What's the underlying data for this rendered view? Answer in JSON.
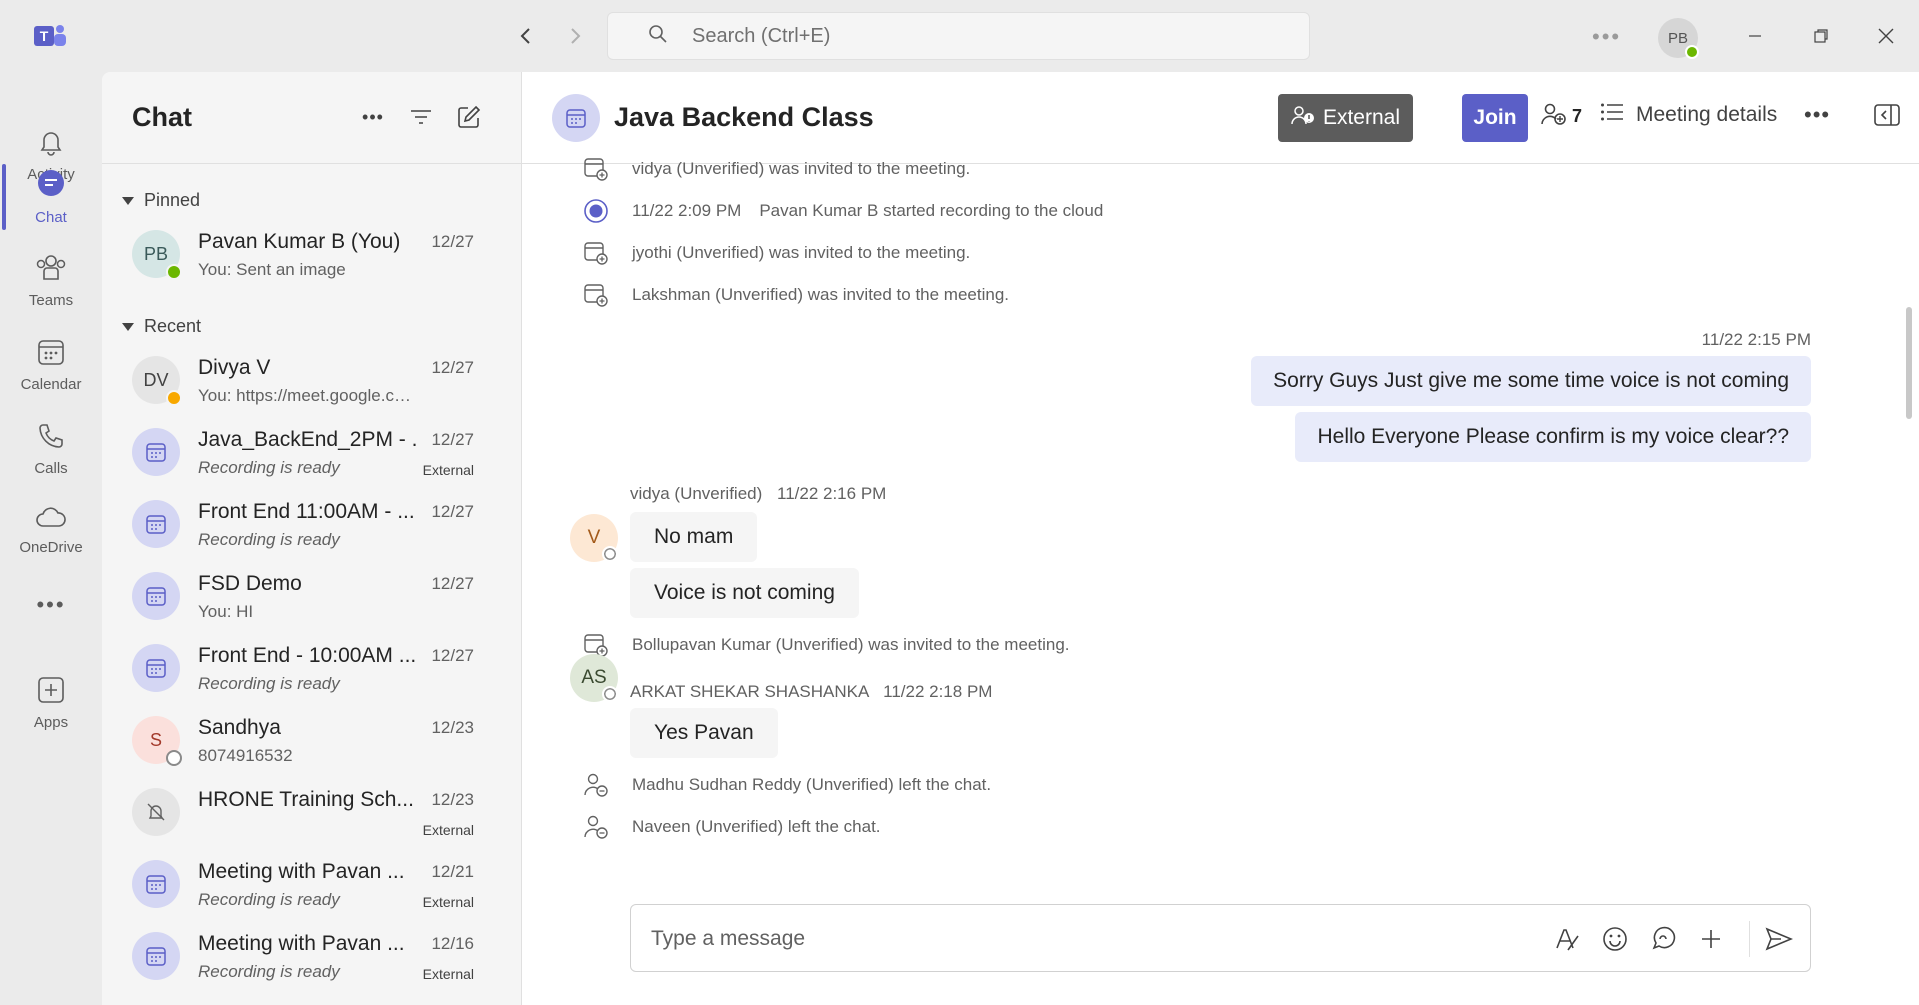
{
  "search": {
    "placeholder": "Search (Ctrl+E)"
  },
  "user": {
    "initials": "PB"
  },
  "rail": [
    {
      "label": "Activity",
      "icon": "bell-icon"
    },
    {
      "label": "Chat",
      "icon": "chat-icon",
      "active": true
    },
    {
      "label": "Teams",
      "icon": "teams-icon"
    },
    {
      "label": "Calendar",
      "icon": "calendar-icon"
    },
    {
      "label": "Calls",
      "icon": "phone-icon"
    },
    {
      "label": "OneDrive",
      "icon": "cloud-icon"
    },
    {
      "label": "...",
      "icon": "more-icon"
    },
    {
      "label": "Apps",
      "icon": "add-app-icon"
    }
  ],
  "chatlist": {
    "title": "Chat",
    "pinned_label": "Pinned",
    "recent_label": "Recent",
    "pinned": [
      {
        "name": "Pavan Kumar B (You)",
        "preview": "You: Sent an image",
        "date": "12/27",
        "initials": "PB",
        "status": "available"
      }
    ],
    "recent": [
      {
        "name": "Divya V",
        "preview": "You: https://meet.google.com/p...",
        "date": "12/27",
        "initials": "DV",
        "status": "away",
        "type": "person"
      },
      {
        "name": "Java_BackEnd_2PM - ...",
        "preview": "Recording is ready",
        "date": "12/27",
        "external": "External",
        "type": "meeting"
      },
      {
        "name": "Front End 11:00AM - ...",
        "preview": "Recording is ready",
        "date": "12/27",
        "type": "meeting"
      },
      {
        "name": "FSD Demo",
        "preview": "You: HI",
        "date": "12/27",
        "type": "meeting"
      },
      {
        "name": "Front End - 10:00AM ...",
        "preview": "Recording is ready",
        "date": "12/27",
        "type": "meeting"
      },
      {
        "name": "Sandhya",
        "preview": "8074916532",
        "date": "12/23",
        "initials": "S",
        "status": "offline",
        "type": "person"
      },
      {
        "name": "HRONE Training Sch...",
        "preview": "",
        "date": "12/23",
        "external": "External",
        "type": "muted"
      },
      {
        "name": "Meeting with Pavan ...",
        "preview": "Recording is ready",
        "date": "12/21",
        "external": "External",
        "type": "meeting"
      },
      {
        "name": "Meeting with Pavan ...",
        "preview": "Recording is ready",
        "date": "12/16",
        "external": "External",
        "type": "meeting"
      }
    ]
  },
  "conversation": {
    "title": "Java Backend Class",
    "external_label": "External",
    "join_label": "Join",
    "participants": "7",
    "details_label": "Meeting details",
    "system_events": [
      {
        "text": "vidya (Unverified) was invited to the meeting.",
        "icon": "invite-icon"
      },
      {
        "time": "11/22 2:09 PM",
        "text": "Pavan Kumar B started recording to the cloud",
        "icon": "record-icon"
      },
      {
        "text": "jyothi (Unverified) was invited to the meeting.",
        "icon": "invite-icon"
      },
      {
        "text": "Lakshman (Unverified) was invited to the meeting.",
        "icon": "invite-icon"
      }
    ],
    "my_time": "11/22 2:15 PM",
    "my_messages": [
      "Sorry Guys Just give me some time voice is not coming",
      "Hello Everyone Please confirm is my voice clear??"
    ],
    "vidya": {
      "sender": "vidya (Unverified)",
      "time": "11/22 2:16 PM",
      "initial": "V",
      "messages": [
        "No mam",
        "Voice is not coming"
      ]
    },
    "invite_bollupavan": "Bollupavan Kumar (Unverified) was invited to the meeting.",
    "arkat": {
      "sender": "ARKAT SHEKAR SHASHANKA",
      "time": "11/22 2:18 PM",
      "initials": "AS",
      "messages": [
        "Yes Pavan"
      ]
    },
    "left_events": [
      "Madhu Sudhan Reddy (Unverified) left the chat.",
      "Naveen (Unverified) left the chat."
    ],
    "composer_placeholder": "Type a message"
  },
  "colors": {
    "brand": "#5b5fc7",
    "mine_bubble": "#e8ebfa",
    "external_btn": "#5c5c5c"
  }
}
